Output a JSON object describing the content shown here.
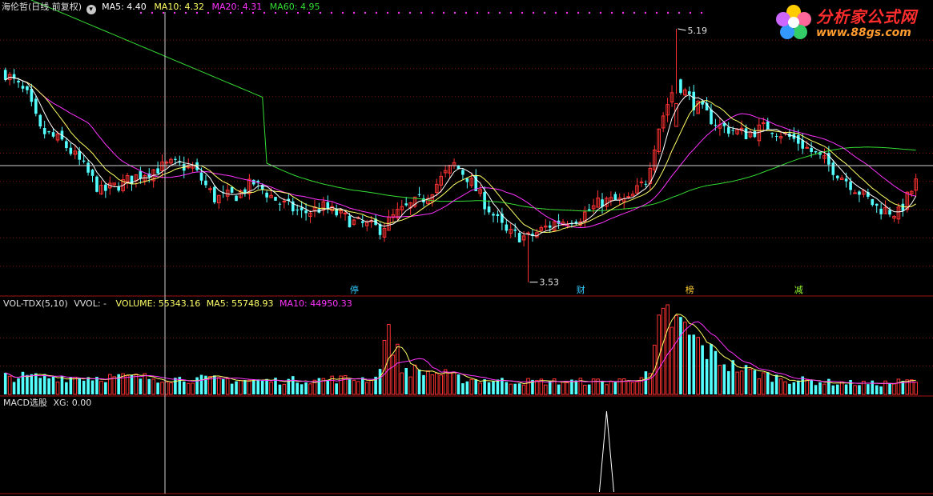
{
  "header": {
    "stock": "海伦哲(日线 前复权)",
    "ma": [
      {
        "label": "MA5: 4.40",
        "color": "#ffffff"
      },
      {
        "label": "MA10: 4.32",
        "color": "#ffff66"
      },
      {
        "label": "MA20: 4.31",
        "color": "#ff33ff"
      },
      {
        "label": "MA60: 4.95",
        "color": "#33dd33"
      }
    ]
  },
  "vol_header": {
    "name": "VOL-TDX(5,10)",
    "vvol": "VVOL: -",
    "volume": "VOLUME: 55343.16",
    "ma5": "MA5: 55748.93",
    "ma10": "MA10: 44950.33"
  },
  "macd_header": {
    "name": "MACD选股",
    "xg": "XG: 0.00"
  },
  "logo": {
    "title": "分析家公式网",
    "url": "www.88gs.com"
  },
  "markers": [
    {
      "text": "停",
      "color": "#33ccff",
      "index": 80
    },
    {
      "text": "财",
      "color": "#33ccff",
      "index": 132
    },
    {
      "text": "榜",
      "color": "#ffcc33",
      "index": 157
    },
    {
      "text": "减",
      "color": "#99ff33",
      "index": 182
    }
  ],
  "annotations": {
    "high": "5.19",
    "low": "3.53"
  },
  "colors": {
    "up": "#ff3232",
    "down": "#54ffff",
    "ma5": "#ffffff",
    "ma10": "#ffff66",
    "ma20": "#ff33ff",
    "ma60": "#33dd33",
    "grid": "#881010",
    "axis": "#a01515"
  },
  "chart_data": {
    "type": "candlestick",
    "n_bars": 210,
    "price_range": [
      3.45,
      5.3
    ],
    "high": 5.19,
    "high_index": 154,
    "low": 3.53,
    "low_index": 120,
    "price_anchors": [
      [
        0,
        4.9
      ],
      [
        5,
        4.75
      ],
      [
        8,
        4.52
      ],
      [
        13,
        4.45
      ],
      [
        17,
        4.32
      ],
      [
        22,
        4.12
      ],
      [
        27,
        4.18
      ],
      [
        32,
        4.25
      ],
      [
        38,
        4.3
      ],
      [
        43,
        4.28
      ],
      [
        48,
        4.08
      ],
      [
        53,
        4.1
      ],
      [
        57,
        4.18
      ],
      [
        63,
        4.05
      ],
      [
        68,
        3.98
      ],
      [
        73,
        4.02
      ],
      [
        80,
        3.92
      ],
      [
        86,
        3.88
      ],
      [
        90,
        3.98
      ],
      [
        96,
        4.08
      ],
      [
        103,
        4.3
      ],
      [
        106,
        4.22
      ],
      [
        110,
        4.05
      ],
      [
        115,
        3.85
      ],
      [
        120,
        3.82
      ],
      [
        126,
        3.92
      ],
      [
        132,
        3.96
      ],
      [
        137,
        4.06
      ],
      [
        143,
        4.06
      ],
      [
        147,
        4.2
      ],
      [
        150,
        4.55
      ],
      [
        154,
        4.85
      ],
      [
        158,
        4.7
      ],
      [
        164,
        4.55
      ],
      [
        170,
        4.5
      ],
      [
        175,
        4.55
      ],
      [
        182,
        4.45
      ],
      [
        188,
        4.32
      ],
      [
        193,
        4.2
      ],
      [
        200,
        4.02
      ],
      [
        205,
        3.98
      ],
      [
        209,
        4.18
      ]
    ],
    "volume_range": [
      0,
      200000
    ],
    "volume_levels": [
      [
        0,
        42000
      ],
      [
        30,
        40000
      ],
      [
        60,
        32000
      ],
      [
        85,
        38000
      ],
      [
        88,
        165000
      ],
      [
        91,
        60000
      ],
      [
        100,
        48000
      ],
      [
        105,
        36000
      ],
      [
        120,
        30000
      ],
      [
        140,
        30000
      ],
      [
        148,
        45000
      ],
      [
        150,
        150000
      ],
      [
        152,
        185000
      ],
      [
        156,
        150000
      ],
      [
        160,
        110000
      ],
      [
        166,
        70000
      ],
      [
        172,
        50000
      ],
      [
        180,
        35000
      ],
      [
        190,
        28000
      ],
      [
        200,
        25000
      ],
      [
        209,
        32000
      ]
    ],
    "macd_xg_signal_index": 138
  }
}
